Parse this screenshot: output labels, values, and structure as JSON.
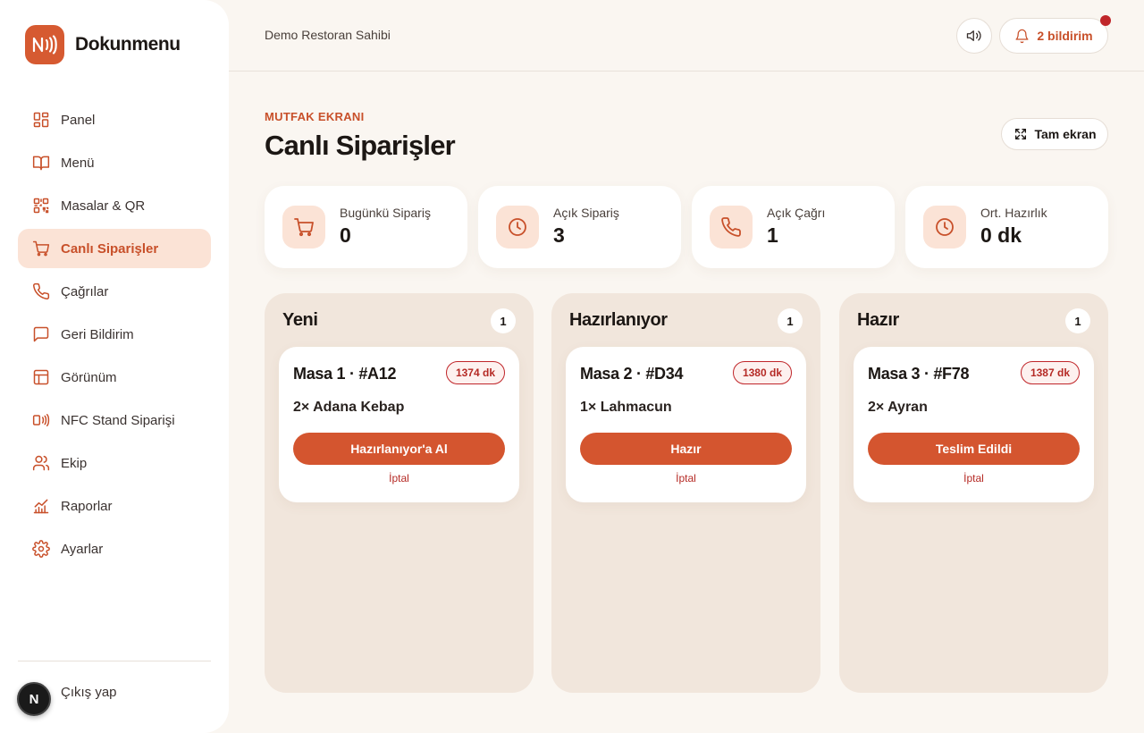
{
  "brand": {
    "name": "Dokunmenu"
  },
  "sidebar": {
    "items": [
      {
        "label": "Panel",
        "icon": "dashboard-icon",
        "active": false
      },
      {
        "label": "Menü",
        "icon": "book-icon",
        "active": false
      },
      {
        "label": "Masalar & QR",
        "icon": "qr-icon",
        "active": false
      },
      {
        "label": "Canlı Siparişler",
        "icon": "cart-icon",
        "active": true
      },
      {
        "label": "Çağrılar",
        "icon": "phone-icon",
        "active": false
      },
      {
        "label": "Geri Bildirim",
        "icon": "message-icon",
        "active": false
      },
      {
        "label": "Görünüm",
        "icon": "layout-icon",
        "active": false
      },
      {
        "label": "NFC Stand Siparişi",
        "icon": "nfc-icon",
        "active": false
      },
      {
        "label": "Ekip",
        "icon": "users-icon",
        "active": false
      },
      {
        "label": "Raporlar",
        "icon": "chart-icon",
        "active": false
      },
      {
        "label": "Ayarlar",
        "icon": "gear-icon",
        "active": false
      }
    ],
    "logout_label": "Çıkış yap",
    "avatar_letter": "N"
  },
  "header": {
    "user_name": "Demo Restoran Sahibi",
    "notifications_label": "2 bildirim"
  },
  "page": {
    "eyebrow": "MUTFAK EKRANI",
    "title": "Canlı Siparişler",
    "fullscreen_label": "Tam ekran"
  },
  "stats": [
    {
      "label": "Bugünkü Sipariş",
      "value": "0",
      "icon": "cart-icon"
    },
    {
      "label": "Açık Sipariş",
      "value": "3",
      "icon": "clock-icon"
    },
    {
      "label": "Açık Çağrı",
      "value": "1",
      "icon": "phone-icon"
    },
    {
      "label": "Ort. Hazırlık",
      "value": "0 dk",
      "icon": "clock-icon"
    }
  ],
  "columns": [
    {
      "title": "Yeni",
      "count": "1",
      "order": {
        "title": "Masa 1 · #A12",
        "time": "1374 dk",
        "item": "2× Adana Kebap",
        "action": "Hazırlanıyor'a Al",
        "cancel": "İptal"
      }
    },
    {
      "title": "Hazırlanıyor",
      "count": "1",
      "order": {
        "title": "Masa 2 · #D34",
        "time": "1380 dk",
        "item": "1× Lahmacun",
        "action": "Hazır",
        "cancel": "İptal"
      }
    },
    {
      "title": "Hazır",
      "count": "1",
      "order": {
        "title": "Masa 3 · #F78",
        "time": "1387 dk",
        "item": "2× Ayran",
        "action": "Teslim Edildi",
        "cancel": "İptal"
      }
    }
  ],
  "colors": {
    "accent": "#d65a31",
    "accent_soft": "#fbe3d6",
    "column_bg": "#f1e6dc",
    "page_bg": "#faf6f1",
    "danger": "#c0262a"
  }
}
